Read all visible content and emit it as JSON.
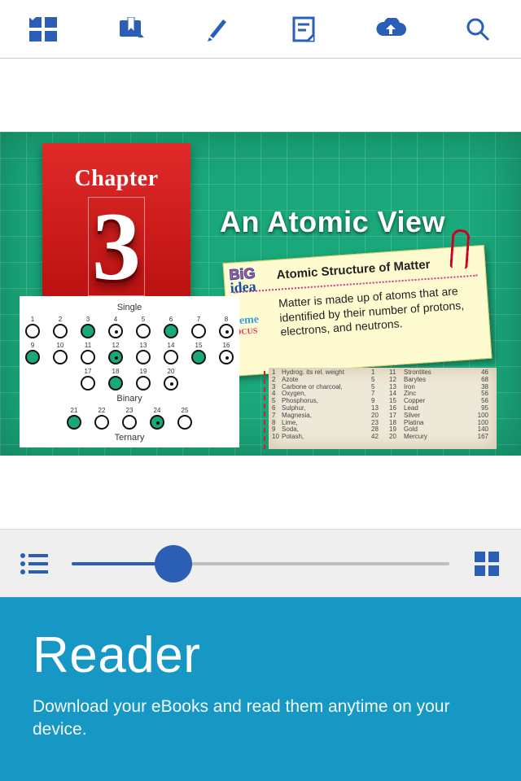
{
  "toolbar": {
    "icons": [
      "menu-panels-icon",
      "bookmark-ribbon-icon",
      "pencil-icon",
      "note-icon",
      "cloud-upload-icon",
      "search-icon"
    ]
  },
  "page": {
    "chapter_label": "Chapter",
    "chapter_number": "3",
    "title": "An Atomic View",
    "big_idea_label_big": "BiG",
    "big_idea_label_idea": "idea",
    "big_idea_text": "Atomic Structure of Matter",
    "theme_label_theme": "theme",
    "theme_label_focus": "FOCUS",
    "theme_text": "Matter is made up of atoms that are identified by their number of protons, electrons, and neutrons.",
    "dalton": {
      "single": "Single",
      "binary": "Binary",
      "ternary": "Ternary",
      "rows": [
        [
          "1",
          "2",
          "3",
          "4",
          "5",
          "6",
          "7",
          "8"
        ],
        [
          "9",
          "10",
          "11",
          "12",
          "13",
          "14",
          "15",
          "16"
        ],
        [
          "17",
          "18",
          "19",
          "20"
        ],
        [
          "21",
          "22",
          "23",
          "24",
          "25"
        ]
      ]
    },
    "elements": [
      [
        "1",
        "Hydrog. its rel. weight",
        "1",
        "11",
        "Strontites",
        "46"
      ],
      [
        "2",
        "Azote",
        "5",
        "12",
        "Barytes",
        "68"
      ],
      [
        "3",
        "Carbone or charcoal,",
        "5",
        "13",
        "Iron",
        "38"
      ],
      [
        "4",
        "Oxygen,",
        "7",
        "14",
        "Zinc",
        "56"
      ],
      [
        "5",
        "Phosphorus,",
        "9",
        "15",
        "Copper",
        "56"
      ],
      [
        "6",
        "Sulphur,",
        "13",
        "16",
        "Lead",
        "95"
      ],
      [
        "7",
        "Magnesia,",
        "20",
        "17",
        "Silver",
        "100"
      ],
      [
        "8",
        "Lime,",
        "23",
        "18",
        "Platina",
        "100"
      ],
      [
        "9",
        "Soda,",
        "28",
        "19",
        "Gold",
        "140"
      ],
      [
        "10",
        "Potash,",
        "42",
        "20",
        "Mercury",
        "167"
      ]
    ]
  },
  "slider": {
    "percent": 27
  },
  "promo": {
    "title": "Reader",
    "subtitle": "Download your eBooks and read them anytime on your device."
  }
}
